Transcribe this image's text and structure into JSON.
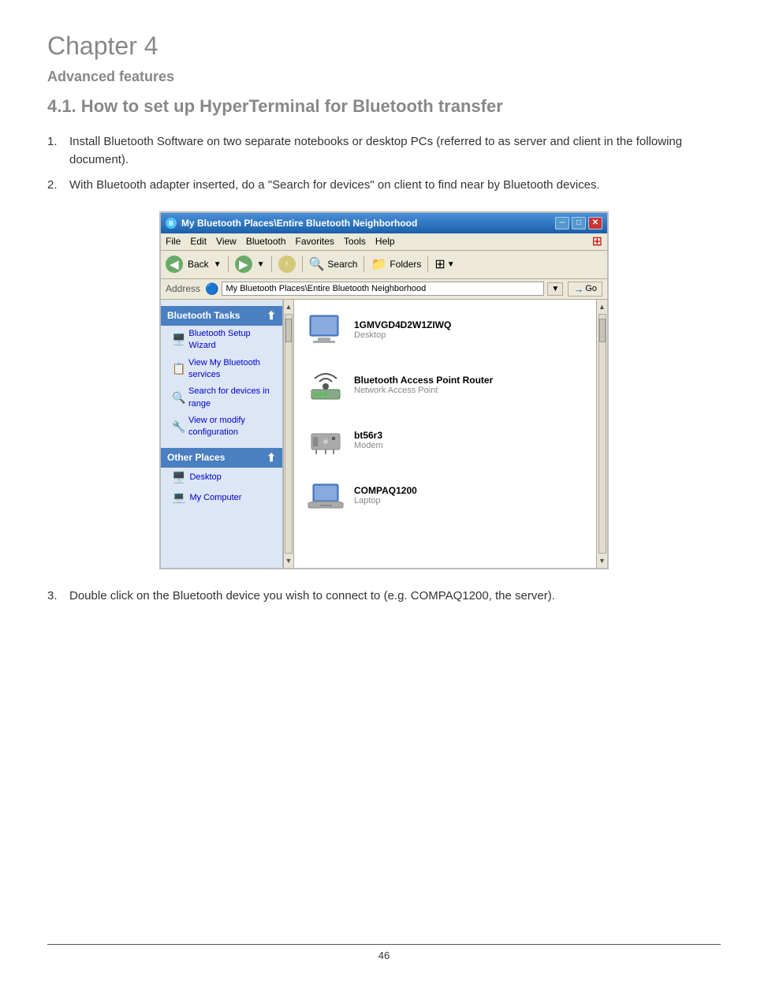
{
  "chapter": {
    "title": "Chapter 4",
    "section": "Advanced features",
    "subsection": "4.1. How to set up HyperTerminal for Bluetooth transfer"
  },
  "steps": [
    {
      "num": "1.",
      "text": "Install Bluetooth Software on two separate notebooks or desktop PCs (referred to as server and client in the following document)."
    },
    {
      "num": "2.",
      "text": "With Bluetooth adapter inserted, do a \"Search for devices\" on client to find near by Bluetooth devices."
    },
    {
      "num": "3.",
      "text": "Double click on the Bluetooth device you wish to connect to (e.g. COMPAQ1200, the server)."
    }
  ],
  "screenshot": {
    "titlebar": "My Bluetooth Places\\Entire Bluetooth Neighborhood",
    "menuItems": [
      "File",
      "Edit",
      "View",
      "Bluetooth",
      "Favorites",
      "Tools",
      "Help"
    ],
    "toolbar": {
      "back": "Back",
      "forward": "Forward",
      "search": "Search",
      "folders": "Folders"
    },
    "addressBar": {
      "label": "Address",
      "value": "My Bluetooth Places\\Entire Bluetooth Neighborhood",
      "goLabel": "Go"
    },
    "sidebar": {
      "sections": [
        {
          "header": "Bluetooth Tasks",
          "items": [
            "Bluetooth Setup Wizard",
            "View My Bluetooth services",
            "Search for devices in range",
            "View or modify configuration"
          ]
        },
        {
          "header": "Other Places",
          "items": [
            "Desktop",
            "My Computer"
          ]
        }
      ]
    },
    "devices": [
      {
        "name": "1GMVGD4D2W1ZIWQ",
        "type": "Desktop",
        "icon": "desktop"
      },
      {
        "name": "Bluetooth Access Point Router",
        "type": "Network Access Point",
        "icon": "network"
      },
      {
        "name": "bt56r3",
        "type": "Modem",
        "icon": "modem"
      },
      {
        "name": "COMPAQ1200",
        "type": "Laptop",
        "icon": "laptop"
      }
    ]
  },
  "footer": {
    "pageNum": "46"
  }
}
